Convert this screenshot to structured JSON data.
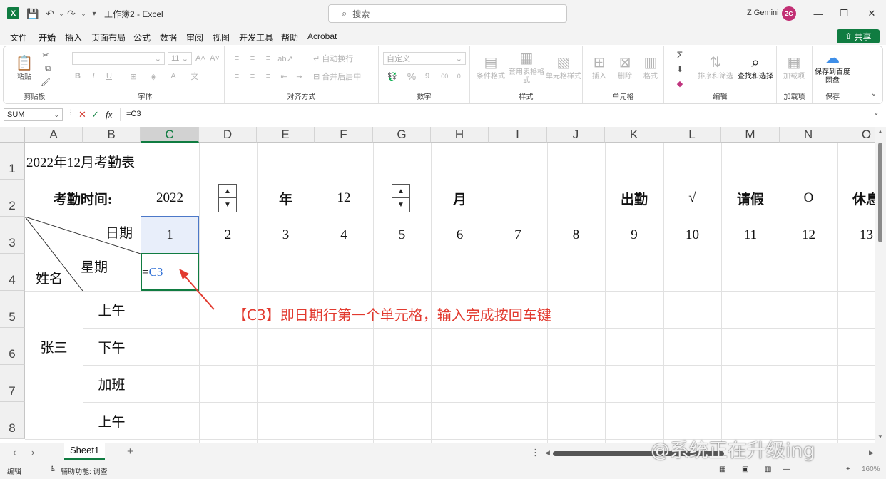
{
  "app": {
    "title": "工作簿2 - Excel",
    "logo": "X",
    "search_placeholder": "搜索",
    "user": "Z Gemini",
    "avatar": "ZG",
    "share": "共享"
  },
  "menu": [
    "文件",
    "开始",
    "插入",
    "页面布局",
    "公式",
    "数据",
    "审阅",
    "视图",
    "开发工具",
    "帮助",
    "Acrobat"
  ],
  "ribbon": {
    "clipboard": {
      "label": "剪贴板",
      "paste": "粘贴"
    },
    "font": {
      "label": "字体",
      "size": "11",
      "bold": "B",
      "italic": "I",
      "underline": "U"
    },
    "alignment": {
      "label": "对齐方式",
      "wrap": "自动换行",
      "merge": "合并后居中"
    },
    "number": {
      "label": "数字",
      "format": "自定义"
    },
    "styles": {
      "label": "样式",
      "conditional": "条件格式",
      "table": "套用表格格式",
      "cell_styles": "单元格样式"
    },
    "cells": {
      "label": "单元格",
      "insert": "插入",
      "delete": "删除",
      "format": "格式"
    },
    "editing": {
      "label": "编辑",
      "sort_filter": "排序和筛选",
      "find_select": "查找和选择"
    },
    "addins": {
      "label": "加载项",
      "button": "加载项"
    },
    "save": {
      "label": "保存",
      "button": "保存到百度网盘"
    }
  },
  "formula_bar": {
    "name_box": "SUM",
    "fx": "fx",
    "formula": "=C3"
  },
  "grid": {
    "columns": [
      "A",
      "B",
      "C",
      "D",
      "E",
      "F",
      "G",
      "H",
      "I",
      "J",
      "K",
      "L",
      "M",
      "N",
      "O"
    ],
    "rows": [
      "1",
      "2",
      "3",
      "4",
      "5",
      "6",
      "7",
      "8"
    ],
    "title": "2022年12月考勤表",
    "attendance_time_label": "考勤时间:",
    "year_value": "2022",
    "year_unit": "年",
    "month_value": "12",
    "month_unit": "月",
    "legend": [
      {
        "label": "出勤",
        "symbol": "√"
      },
      {
        "label": "请假",
        "symbol": "O"
      },
      {
        "label": "休息"
      }
    ],
    "header_date": "日期",
    "header_weekday": "星期",
    "header_name": "姓名",
    "dates": [
      "1",
      "2",
      "3",
      "4",
      "5",
      "6",
      "7",
      "8",
      "9",
      "10",
      "11",
      "12",
      "13"
    ],
    "editing_prefix": "=",
    "editing_ref": "C3",
    "employee": "张三",
    "shifts": [
      "上午",
      "下午",
      "加班",
      "上午"
    ]
  },
  "annotation": "【C3】即日期行第一个单元格，输入完成按回车键",
  "sheets": {
    "active": "Sheet1",
    "add": "+"
  },
  "status": {
    "mode": "编辑",
    "accessibility": "辅助功能: 调查",
    "zoom": "160%"
  },
  "watermark": "@系统正在升级ing",
  "colors": {
    "accent": "#107c41",
    "annotation": "#e23a2f",
    "formula_ref": "#2f6fd6"
  }
}
